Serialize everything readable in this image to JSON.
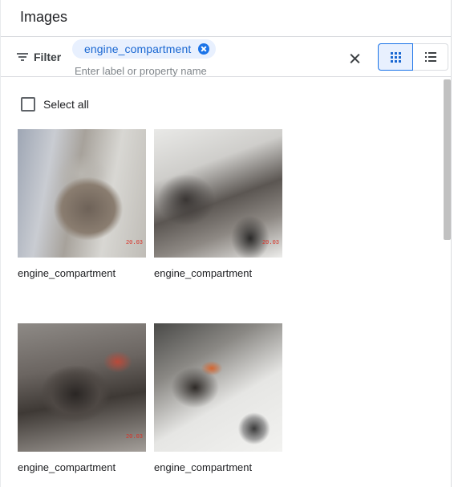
{
  "header": {
    "title": "Images"
  },
  "filterbar": {
    "filter_label": "Filter",
    "chip_label": "engine_compartment",
    "input_placeholder": "Enter label or property name",
    "view_mode": "grid"
  },
  "content": {
    "select_all_label": "Select all",
    "images": [
      {
        "label": "engine_compartment",
        "stamp": "20.03"
      },
      {
        "label": "engine_compartment",
        "stamp": "20.03"
      },
      {
        "label": "engine_compartment",
        "stamp": "20.03"
      },
      {
        "label": "engine_compartment",
        "stamp": ""
      }
    ]
  },
  "colors": {
    "accent": "#1a73e8",
    "chip_bg": "#e8f0fe",
    "chip_text": "#1967d2",
    "border": "#dadce0"
  }
}
